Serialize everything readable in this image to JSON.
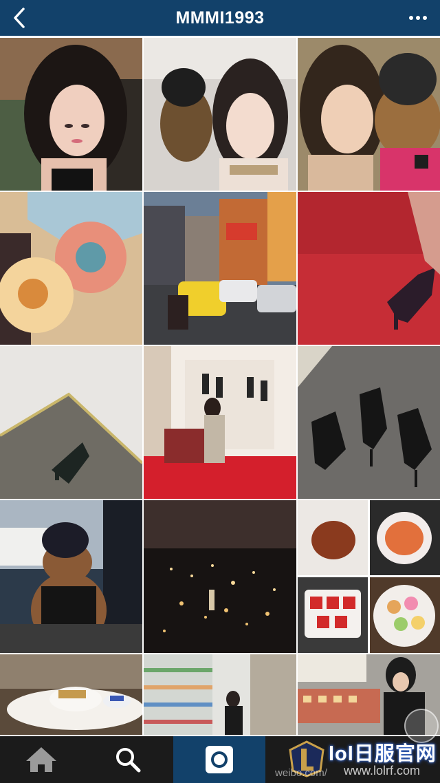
{
  "header": {
    "title": "MMMI1993",
    "back_icon": "chevron-left-icon",
    "more_icon": "more-horizontal-icon",
    "background_color": "#12416a"
  },
  "grid": {
    "columns": 3,
    "tiles": [
      {
        "subject": "selfie-woman-cafe"
      },
      {
        "subject": "selfie-with-teddy-bear"
      },
      {
        "subject": "woman-hugging-teddy-bear"
      },
      {
        "subject": "felt-flowers"
      },
      {
        "subject": "bangkok-street-taxi"
      },
      {
        "subject": "red-carpet-studded-heel"
      },
      {
        "subject": "heel-on-tile-floor"
      },
      {
        "subject": "woman-in-shoe-boutique"
      },
      {
        "subject": "black-strappy-heels"
      },
      {
        "subject": "teddy-bear-in-window"
      },
      {
        "subject": "city-night-view"
      },
      {
        "subject": "food-collage"
      },
      {
        "subject": "cafe-table-snacks"
      },
      {
        "subject": "pharmacy-shelves"
      },
      {
        "subject": "shop-counter"
      }
    ]
  },
  "tabbar": {
    "tabs": [
      {
        "id": "home",
        "icon": "home-icon"
      },
      {
        "id": "search",
        "icon": "search-icon"
      },
      {
        "id": "camera",
        "icon": "camera-icon",
        "active": true
      }
    ],
    "background_color": "#1b1b1b",
    "active_color": "#12416a"
  },
  "watermark": {
    "brand": "lol日服官网",
    "url": "www.lolrf.com",
    "weibo": "weibo.com/"
  }
}
